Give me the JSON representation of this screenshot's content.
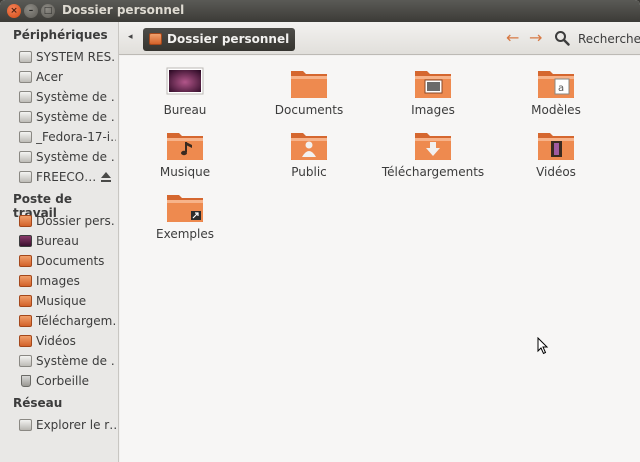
{
  "window": {
    "title": "Dossier personnel"
  },
  "titlebar": {
    "close": "×",
    "minimize": "–",
    "maximize": "□"
  },
  "sidebar": {
    "sections": [
      {
        "heading": "Périphériques",
        "items": [
          {
            "label": "SYSTEM RES…",
            "icon": "drive-icon"
          },
          {
            "label": "Acer",
            "icon": "drive-icon"
          },
          {
            "label": "Système de …",
            "icon": "drive-icon"
          },
          {
            "label": "Système de …",
            "icon": "drive-icon"
          },
          {
            "label": "_Fedora-17-i…",
            "icon": "drive-icon"
          },
          {
            "label": "Système de …",
            "icon": "drive-icon"
          },
          {
            "label": "FREECO…",
            "icon": "drive-icon",
            "eject": true
          }
        ]
      },
      {
        "heading": "Poste de travail",
        "items": [
          {
            "label": "Dossier pers…",
            "icon": "home-folder-icon"
          },
          {
            "label": "Bureau",
            "icon": "desktop-icon"
          },
          {
            "label": "Documents",
            "icon": "folder-icon"
          },
          {
            "label": "Images",
            "icon": "folder-icon"
          },
          {
            "label": "Musique",
            "icon": "folder-icon"
          },
          {
            "label": "Téléchargem…",
            "icon": "folder-icon"
          },
          {
            "label": "Vidéos",
            "icon": "folder-icon"
          },
          {
            "label": "Système de …",
            "icon": "drive-icon"
          },
          {
            "label": "Corbeille",
            "icon": "trash-icon"
          }
        ]
      },
      {
        "heading": "Réseau",
        "items": [
          {
            "label": "Explorer le r…",
            "icon": "network-icon"
          }
        ]
      }
    ]
  },
  "toolbar": {
    "breadcrumb": "Dossier personnel",
    "back_glyph": "◂",
    "prev_glyph": "←",
    "next_glyph": "→",
    "search_label": "Recherche"
  },
  "files": [
    {
      "label": "Bureau",
      "emblem": "desktop"
    },
    {
      "label": "Documents",
      "emblem": "none"
    },
    {
      "label": "Images",
      "emblem": "images"
    },
    {
      "label": "Modèles",
      "emblem": "templates"
    },
    {
      "label": "Musique",
      "emblem": "music"
    },
    {
      "label": "Public",
      "emblem": "public"
    },
    {
      "label": "Téléchargements",
      "emblem": "download"
    },
    {
      "label": "Vidéos",
      "emblem": "video"
    },
    {
      "label": "Exemples",
      "emblem": "link"
    }
  ],
  "colors": {
    "accent": "#dd4814",
    "folder": "#e27a3f",
    "titlebar": "#3c3b37"
  }
}
